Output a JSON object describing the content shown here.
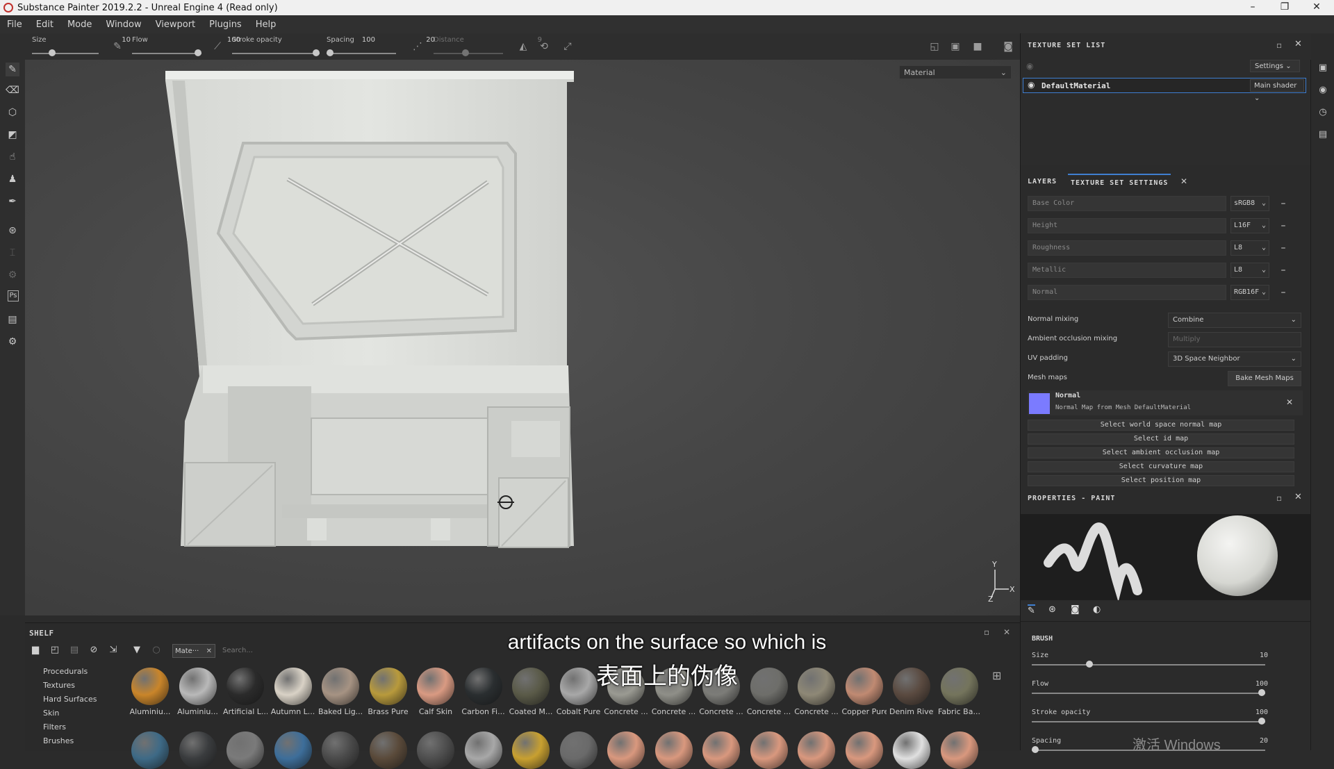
{
  "window": {
    "title": "Substance Painter 2019.2.2 - Unreal Engine 4 (Read only)",
    "controls": [
      "–",
      "❐",
      "✕"
    ]
  },
  "menu": [
    "File",
    "Edit",
    "Mode",
    "Window",
    "Viewport",
    "Plugins",
    "Help"
  ],
  "toolbar": {
    "params": [
      {
        "label": "Size",
        "value": "10",
        "fill": 0.28
      },
      {
        "label": "Flow",
        "value": "100",
        "fill": 1.0
      },
      {
        "label": "Stroke opacity",
        "value": "100",
        "fill": 1.0
      },
      {
        "label": "Spacing",
        "value": "20",
        "fill": 0.0
      },
      {
        "label": "Distance",
        "value": "9",
        "fill": 0.45
      }
    ]
  },
  "viewport": {
    "mode": "Material",
    "gizmo": {
      "y": "Y",
      "x": "X",
      "z": "Z"
    }
  },
  "texture_set_list": {
    "header": "TEXTURE SET LIST",
    "settings": "Settings",
    "item": {
      "name": "DefaultMaterial",
      "shader": "Main shader"
    }
  },
  "texture_set_settings": {
    "tabs": [
      "LAYERS",
      "TEXTURE SET SETTINGS"
    ],
    "channels": [
      {
        "name": "Base Color",
        "format": "sRGB8"
      },
      {
        "name": "Height",
        "format": "L16F"
      },
      {
        "name": "Roughness",
        "format": "L8"
      },
      {
        "name": "Metallic",
        "format": "L8"
      },
      {
        "name": "Normal",
        "format": "RGB16F"
      }
    ],
    "normal_mixing": {
      "label": "Normal mixing",
      "value": "Combine"
    },
    "ao_mixing": {
      "label": "Ambient occlusion mixing",
      "value": "Multiply"
    },
    "uv_padding": {
      "label": "UV padding",
      "value": "3D Space Neighbor"
    },
    "mesh_maps": {
      "label": "Mesh maps",
      "bake_button": "Bake Mesh Maps"
    },
    "normal_map": {
      "title": "Normal",
      "desc": "Normal Map from Mesh DefaultMaterial"
    },
    "select_buttons": [
      "Select world space normal map",
      "Select id map",
      "Select ambient occlusion map",
      "Select curvature map",
      "Select position map"
    ]
  },
  "properties": {
    "header": "PROPERTIES - PAINT",
    "section": "BRUSH",
    "sliders": [
      {
        "label": "Size",
        "value": "10",
        "fill": 0.24
      },
      {
        "label": "Flow",
        "value": "100",
        "fill": 1.0
      },
      {
        "label": "Stroke opacity",
        "value": "100",
        "fill": 1.0
      },
      {
        "label": "Spacing",
        "value": "20",
        "fill": 0.0
      }
    ]
  },
  "shelf": {
    "header": "SHELF",
    "filter_tag": "Mate···",
    "search_placeholder": "Search...",
    "categories": [
      "Procedurals",
      "Textures",
      "Hard Surfaces",
      "Skin",
      "Filters",
      "Brushes"
    ],
    "materials": [
      {
        "name": "Aluminiu...",
        "color": "#c9852a"
      },
      {
        "name": "Aluminiu...",
        "color": "#b9b9b9"
      },
      {
        "name": "Artificial L...",
        "color": "#2b2b2b"
      },
      {
        "name": "Autumn L...",
        "color": "#d9d2c6"
      },
      {
        "name": "Baked Lig...",
        "color": "#a69383"
      },
      {
        "name": "Brass Pure",
        "color": "#b89a3c"
      },
      {
        "name": "Calf Skin",
        "color": "#d99a82"
      },
      {
        "name": "Carbon Fi...",
        "color": "#2a2e30"
      },
      {
        "name": "Coated M...",
        "color": "#5a5a48"
      },
      {
        "name": "Cobalt Pure",
        "color": "#a8a8a8"
      },
      {
        "name": "Concrete ...",
        "color": "#9a9a92"
      },
      {
        "name": "Concrete ...",
        "color": "#8f8f88"
      },
      {
        "name": "Concrete ...",
        "color": "#7c7c78"
      },
      {
        "name": "Concrete ...",
        "color": "#6e6e6a"
      },
      {
        "name": "Concrete ...",
        "color": "#8e8876"
      },
      {
        "name": "Copper Pure",
        "color": "#c08a72"
      },
      {
        "name": "Denim Rivet",
        "color": "#5a4a40"
      },
      {
        "name": "Fabric Ba...",
        "color": "#74745c"
      }
    ],
    "row2_colors": [
      "#3e6a86",
      "#3a3c3e",
      "#7a7a7a",
      "#3d6e9a",
      "#4a4a4a",
      "#5a4a3a",
      "#4e4e4e",
      "#a8a8a8",
      "#c8a030",
      "#6a6a6a",
      "#d9987e",
      "#d9987e",
      "#d9987e",
      "#d9987e",
      "#d9987e",
      "#d9987e",
      "#e0e0e0",
      "#d9987e"
    ]
  },
  "subtitle": {
    "en": "artifacts on the surface so which is",
    "zh": "表面上的伪像"
  },
  "watermark": "激活 Windows"
}
